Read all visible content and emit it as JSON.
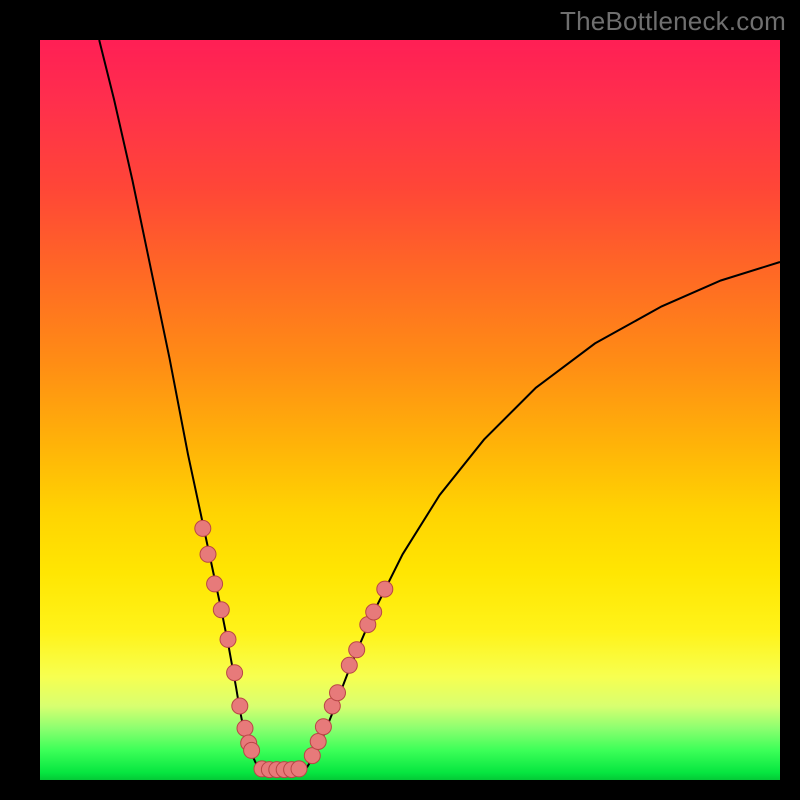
{
  "watermark": "TheBottleneck.com",
  "colors": {
    "frame": "#000000",
    "curve_stroke": "#000000",
    "dot_fill": "#e77a7a",
    "dot_stroke": "#b94646",
    "gradient_stops": [
      "#ff1f55",
      "#ff2e4d",
      "#ff4637",
      "#ff6a24",
      "#ff8e14",
      "#ffb408",
      "#ffd402",
      "#ffe602",
      "#fff31a",
      "#f7ff50",
      "#d8ff70",
      "#8cff70",
      "#3cff58",
      "#06e640",
      "#03c936"
    ]
  },
  "chart_data": {
    "type": "line",
    "title": "",
    "xlabel": "",
    "ylabel": "",
    "xlim": [
      0,
      100
    ],
    "ylim": [
      0,
      100
    ],
    "series": [
      {
        "name": "curve-left",
        "x": [
          8.0,
          10.0,
          12.5,
          15.0,
          17.5,
          20.0,
          21.5,
          23.0,
          24.5,
          25.5,
          26.5,
          27.0,
          27.5,
          28.0,
          28.7,
          29.3,
          30.0
        ],
        "values": [
          100.0,
          92.0,
          81.0,
          69.0,
          57.0,
          44.0,
          37.0,
          30.0,
          23.0,
          18.0,
          12.5,
          9.5,
          7.0,
          5.0,
          3.3,
          2.0,
          1.5
        ]
      },
      {
        "name": "curve-bottom",
        "x": [
          30.0,
          31.0,
          32.0,
          33.0,
          34.0,
          35.0,
          36.0
        ],
        "values": [
          1.5,
          1.4,
          1.4,
          1.4,
          1.4,
          1.5,
          1.6
        ]
      },
      {
        "name": "curve-right",
        "x": [
          36.0,
          37.5,
          39.5,
          42.0,
          45.0,
          49.0,
          54.0,
          60.0,
          67.0,
          75.0,
          84.0,
          92.0,
          100.0
        ],
        "values": [
          1.6,
          4.0,
          9.0,
          15.5,
          22.5,
          30.5,
          38.5,
          46.0,
          53.0,
          59.0,
          64.0,
          67.5,
          70.0
        ]
      }
    ],
    "scatter": {
      "name": "dots",
      "x": [
        22.0,
        22.7,
        23.6,
        24.5,
        25.4,
        26.3,
        27.0,
        27.7,
        28.2,
        28.6,
        30.0,
        31.0,
        32.0,
        33.0,
        34.0,
        35.0,
        36.8,
        37.6,
        38.3,
        39.5,
        40.2,
        41.8,
        42.8,
        44.3,
        45.1,
        46.6
      ],
      "values": [
        34.0,
        30.5,
        26.5,
        23.0,
        19.0,
        14.5,
        10.0,
        7.0,
        5.0,
        4.0,
        1.5,
        1.4,
        1.4,
        1.4,
        1.4,
        1.5,
        3.3,
        5.2,
        7.2,
        10.0,
        11.8,
        15.5,
        17.6,
        21.0,
        22.7,
        25.8
      ]
    }
  }
}
